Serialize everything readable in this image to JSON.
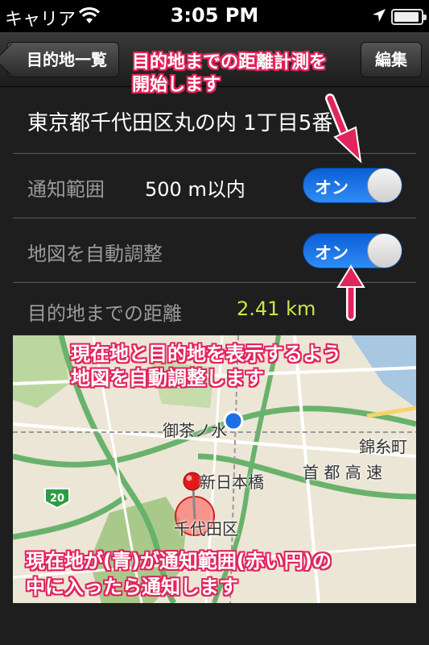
{
  "status_bar": {
    "carrier": "キャリア",
    "time": "3:05 PM"
  },
  "nav": {
    "back_label": "目的地一覧",
    "edit_label": "編集"
  },
  "detail": {
    "address": "東京都千代田区丸の内 1丁目5番",
    "range_label": "通知範囲",
    "range_value": "500 m以内",
    "range_toggle": "オン",
    "auto_adjust_label": "地図を自動調整",
    "auto_adjust_toggle": "オン",
    "distance_label": "目的地までの距離",
    "distance_value": "2.41 km"
  },
  "map": {
    "labels": {
      "ochanomizu": "御茶ノ水",
      "shin_nihonbashi": "新日本橋",
      "chiyoda": "千代田区",
      "kinshicho": "錦糸町",
      "shuto": "首 都 高 速",
      "route_number": "20"
    },
    "current_color": "#1e6fe6",
    "pin_color": "#e01a1a",
    "range_fill": "#ff5050"
  },
  "annotations": {
    "toggle_distance_line1": "目的地までの距離計測を",
    "toggle_distance_line2": "開始します",
    "auto_adjust_line1": "現在地と目的地を表示するよう",
    "auto_adjust_line2": "地図を自動調整します",
    "range_line1": "現在地が(青)が通知範囲(赤い円)の",
    "range_line2": "中に入ったら通知します",
    "color": "#e2245d"
  }
}
